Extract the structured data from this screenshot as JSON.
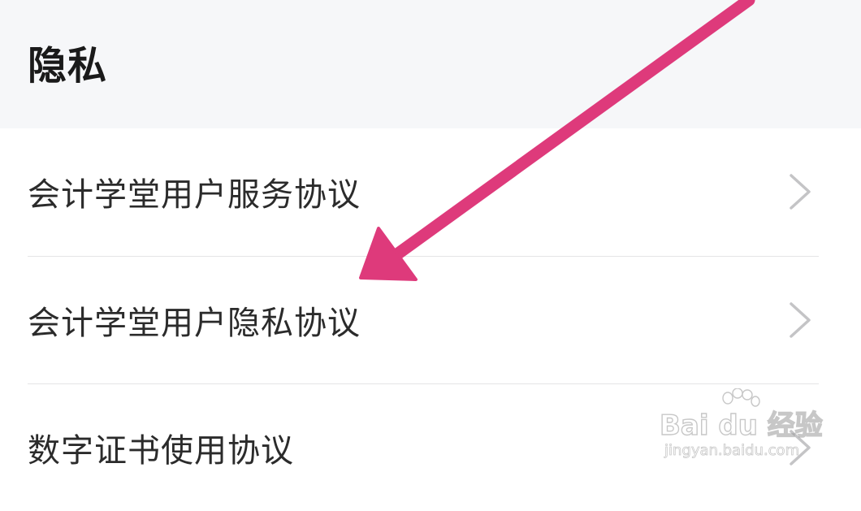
{
  "section": {
    "title": "隐私"
  },
  "items": [
    {
      "label": "会计学堂用户服务协议",
      "icon": "chevron-right-icon"
    },
    {
      "label": "会计学堂用户隐私协议",
      "icon": "chevron-right-icon"
    },
    {
      "label": "数字证书使用协议",
      "icon": "chevron-right-icon"
    }
  ],
  "annotation": {
    "color": "#de3a7b",
    "icon": "pointer-arrow"
  },
  "watermark": {
    "brand": "Bai du 经验",
    "url": "jingyan.baidu.com"
  },
  "colors": {
    "header_background": "#f6f7f9",
    "text": "#2b2b2b",
    "chevron": "#c4c4c6",
    "divider": "#e4e4e6"
  }
}
